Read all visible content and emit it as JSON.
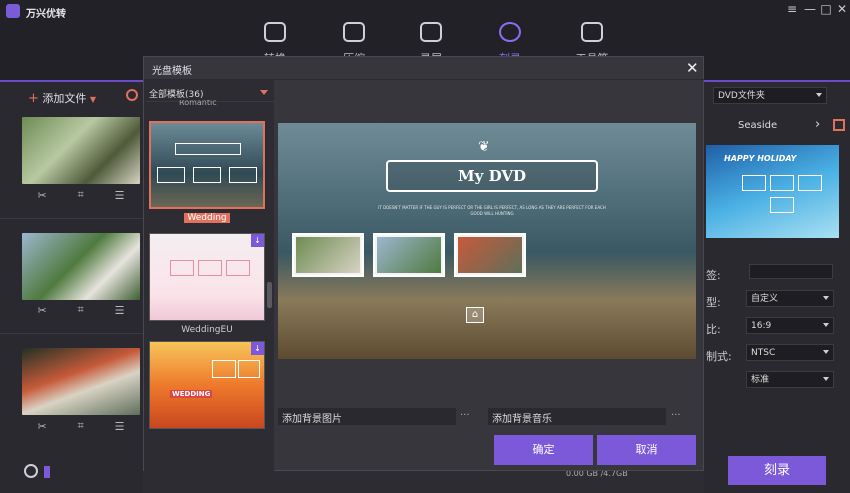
{
  "app": {
    "title": "万兴优转"
  },
  "window_controls": [
    "≡",
    "—",
    "□",
    "✕"
  ],
  "nav": {
    "tabs": [
      {
        "label": "转换",
        "icon": "convert-icon"
      },
      {
        "label": "压缩",
        "icon": "compress-icon"
      },
      {
        "label": "录屏",
        "icon": "record-icon"
      },
      {
        "label": "刻录",
        "icon": "burn-icon",
        "active": true
      },
      {
        "label": "工具箱",
        "icon": "toolbox-icon"
      }
    ]
  },
  "left": {
    "add_file": "添加文件"
  },
  "modal": {
    "title": "光盘模板",
    "filter": "全部模板(36)",
    "partial_label": "Romantic",
    "templates": [
      {
        "name": "Wedding",
        "selected": true
      },
      {
        "name": "WeddingEU",
        "download": true
      },
      {
        "name": "",
        "download": true
      }
    ],
    "thumb_text": {
      "wedding": "WEDDING"
    },
    "preview": {
      "title": "My DVD",
      "tagline": "IT DOESN'T MATTER IF THE GUY IS PERFECT OR THE GIRL IS PERFECT, AS LONG AS THEY ARE PERFECT FOR EACH OTHER",
      "tagline2": "GOOD WILL HUNTING"
    },
    "add_bg": "添加背景图片",
    "add_music": "添加背景音乐",
    "dots": "···",
    "confirm": "确定",
    "cancel": "取消"
  },
  "right": {
    "folder": "DVD文件夹",
    "template_name": "Seaside",
    "holiday": "HAPPY HOLIDAY",
    "menu_label": "自定义",
    "aspect": "16:9",
    "tv": "NTSC",
    "quality": "标准",
    "labels": [
      "签:",
      "型:",
      "比:",
      "制式:"
    ],
    "burn": "刻录"
  },
  "status": {
    "time": "0.00 GB /4.7GB"
  }
}
